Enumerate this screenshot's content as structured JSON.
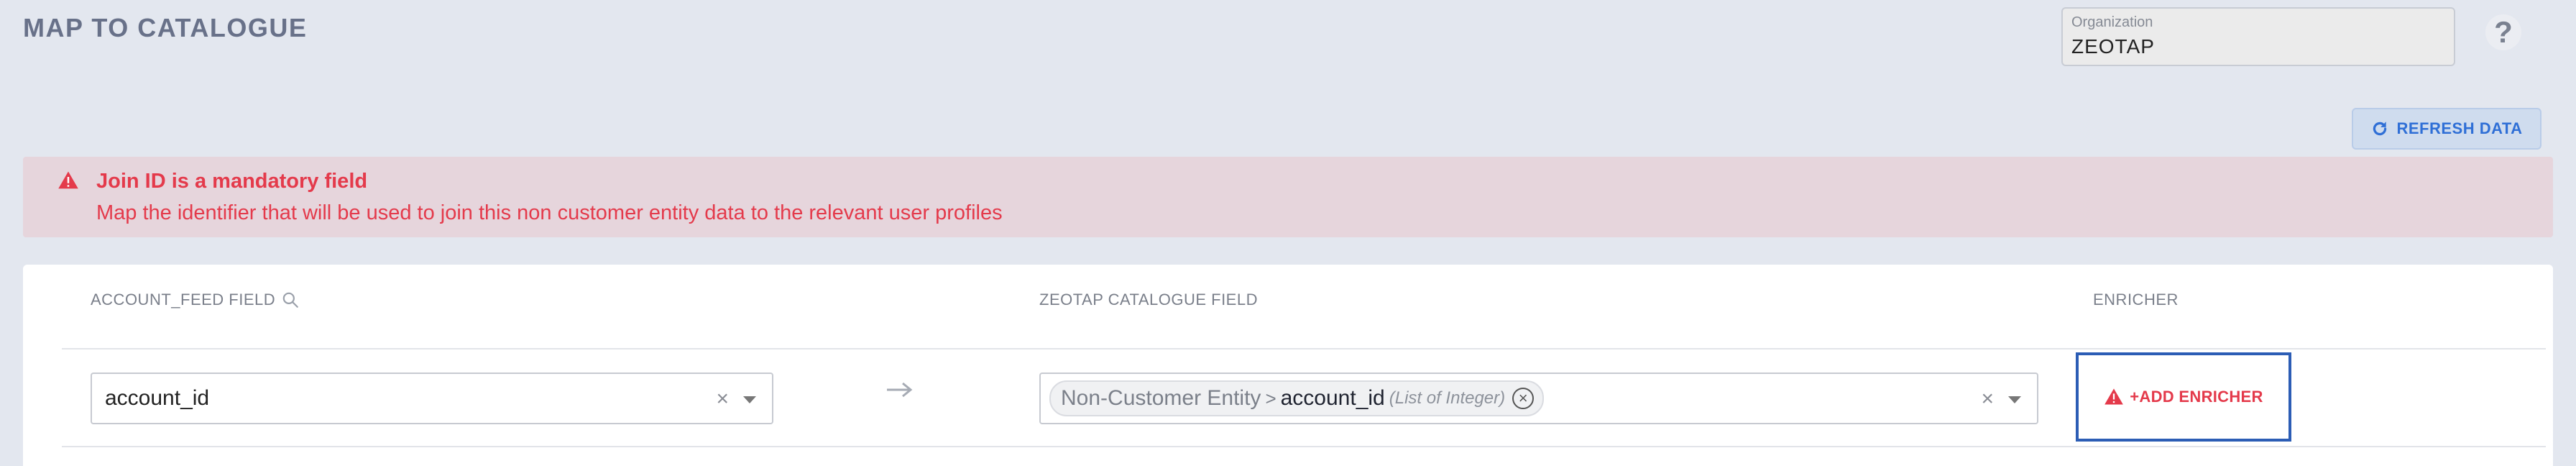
{
  "header": {
    "title": "MAP TO CATALOGUE",
    "org_label": "Organization",
    "org_value": "ZEOTAP",
    "help_label": "?"
  },
  "toolbar": {
    "refresh_label": "REFRESH DATA"
  },
  "alert": {
    "title": "Join ID is a mandatory field",
    "description": "Map the identifier that will be used to join this non customer entity data to the relevant user profiles"
  },
  "table": {
    "col_source": "ACCOUNT_FEED FIELD",
    "col_target": "ZEOTAP CATALOGUE FIELD",
    "col_enricher": "ENRICHER",
    "row": {
      "source_value": "account_id",
      "clear_symbol": "×",
      "target_path": "Non-Customer Entity",
      "target_sep": ">",
      "target_name": "account_id",
      "target_type": "(List of Integer)",
      "chip_remove_symbol": "×",
      "enricher_label": "+ADD ENRICHER"
    }
  },
  "colors": {
    "background": "#e3e7ef",
    "error": "#e43a4b",
    "accent": "#2f6fd6",
    "highlight_border": "#2c5db5"
  },
  "icons": {
    "search": "search-icon",
    "refresh": "refresh-icon",
    "warning": "warning-icon",
    "arrow": "arrow-right-icon"
  }
}
